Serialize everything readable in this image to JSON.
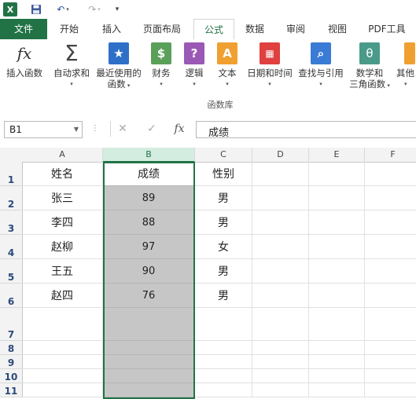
{
  "quick_access": {
    "app_icon": "excel-icon",
    "save_icon": "save-icon",
    "undo_icon": "undo-icon",
    "redo_icon": "redo-icon",
    "customize_icon": "customize-icon"
  },
  "tabs": [
    {
      "label": "文件"
    },
    {
      "label": "开始"
    },
    {
      "label": "插入"
    },
    {
      "label": "页面布局"
    },
    {
      "label": "公式"
    },
    {
      "label": "数据"
    },
    {
      "label": "审阅"
    },
    {
      "label": "视图"
    },
    {
      "label": "PDF工具"
    }
  ],
  "ribbon": {
    "buttons": [
      {
        "line1": "插入函数",
        "line2": "",
        "dropdown": false,
        "icon": "fx-icon"
      },
      {
        "line1": "自动求和",
        "line2": "",
        "dropdown": true,
        "icon": "sigma-icon"
      },
      {
        "line1": "最近使用的",
        "line2": "函数",
        "dropdown": true,
        "icon": "star-icon"
      },
      {
        "line1": "财务",
        "line2": "",
        "dropdown": true,
        "icon": "finance-icon"
      },
      {
        "line1": "逻辑",
        "line2": "",
        "dropdown": true,
        "icon": "logic-icon"
      },
      {
        "line1": "文本",
        "line2": "",
        "dropdown": true,
        "icon": "text-icon"
      },
      {
        "line1": "日期和时间",
        "line2": "",
        "dropdown": true,
        "icon": "calendar-icon"
      },
      {
        "line1": "查找与引用",
        "line2": "",
        "dropdown": true,
        "icon": "lookup-icon"
      },
      {
        "line1": "数学和",
        "line2": "三角函数",
        "dropdown": true,
        "icon": "math-icon"
      },
      {
        "line1": "其他",
        "line2": "",
        "dropdown": true,
        "icon": "more-functions-icon"
      }
    ],
    "group_label": "函数库",
    "colors": {
      "finance": "#5aa05a",
      "logic": "#9b59b6",
      "text": "#f0a030",
      "date": "#e04040",
      "lookup": "#3a7bd5",
      "math": "#4a9a8a",
      "recent": "#2e6fc7"
    }
  },
  "formula_bar": {
    "name_box": "B1",
    "cancel_glyph": "✕",
    "enter_glyph": "✓",
    "fx_glyph": "fx",
    "content": "成绩"
  },
  "grid": {
    "columns": [
      "A",
      "B",
      "C",
      "D",
      "E",
      "F"
    ],
    "selected_column": "B",
    "rows": [
      {
        "num": "1",
        "cells": [
          "姓名",
          "成绩",
          "性别",
          "",
          "",
          ""
        ]
      },
      {
        "num": "2",
        "cells": [
          "张三",
          "89",
          "男",
          "",
          "",
          ""
        ]
      },
      {
        "num": "3",
        "cells": [
          "李四",
          "88",
          "男",
          "",
          "",
          ""
        ]
      },
      {
        "num": "4",
        "cells": [
          "赵柳",
          "97",
          "女",
          "",
          "",
          ""
        ]
      },
      {
        "num": "5",
        "cells": [
          "王五",
          "90",
          "男",
          "",
          "",
          ""
        ]
      },
      {
        "num": "6",
        "cells": [
          "赵四",
          "76",
          "男",
          "",
          "",
          ""
        ]
      },
      {
        "num": "7",
        "cells": [
          "",
          "",
          "",
          "",
          "",
          ""
        ]
      },
      {
        "num": "8",
        "cells": [
          "",
          "",
          "",
          "",
          "",
          ""
        ]
      },
      {
        "num": "9",
        "cells": [
          "",
          "",
          "",
          "",
          "",
          ""
        ]
      },
      {
        "num": "10",
        "cells": [
          "",
          "",
          "",
          "",
          "",
          ""
        ]
      },
      {
        "num": "11",
        "cells": [
          "",
          "",
          "",
          "",
          "",
          ""
        ]
      }
    ],
    "accent_color": "#217346"
  }
}
